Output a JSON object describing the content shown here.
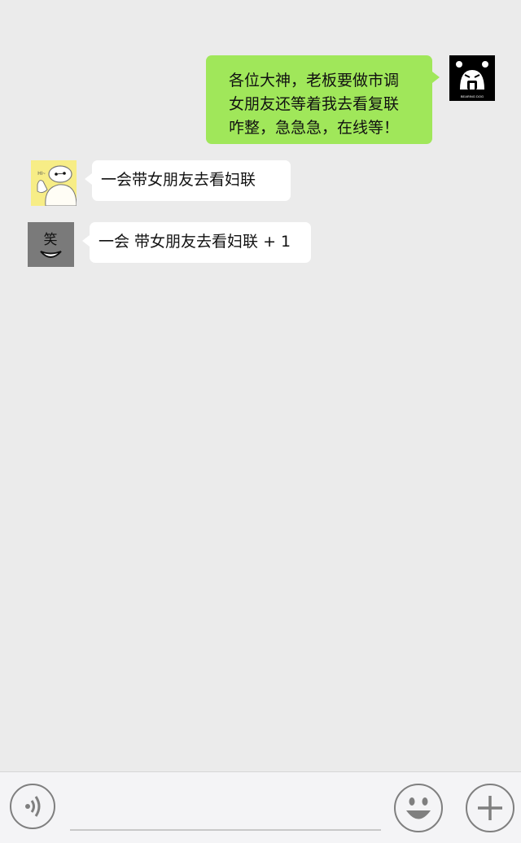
{
  "messages": [
    {
      "sender": "me",
      "avatar_icon": "angry-bear-avatar",
      "avatar_caption": "BEARING DOG",
      "text": "各位大神，老板要做市调\n女朋友还等着我去看复联\n咋整，急急急，在线等！"
    },
    {
      "sender": "other",
      "avatar_icon": "baymax-avatar",
      "avatar_caption": "HI~",
      "text": "一会带女朋友去看妇联"
    },
    {
      "sender": "other",
      "avatar_icon": "laughing-face-avatar",
      "avatar_caption": "笑",
      "text": "一会 带女朋友去看妇联 + 1"
    }
  ],
  "input_bar": {
    "voice_icon": "voice-icon",
    "emoji_icon": "emoji-icon",
    "plus_icon": "plus-icon",
    "input_value": ""
  },
  "colors": {
    "background": "#ebebeb",
    "my_bubble": "#a0e75a",
    "other_bubble": "#ffffff",
    "input_bar": "#f4f4f6"
  }
}
